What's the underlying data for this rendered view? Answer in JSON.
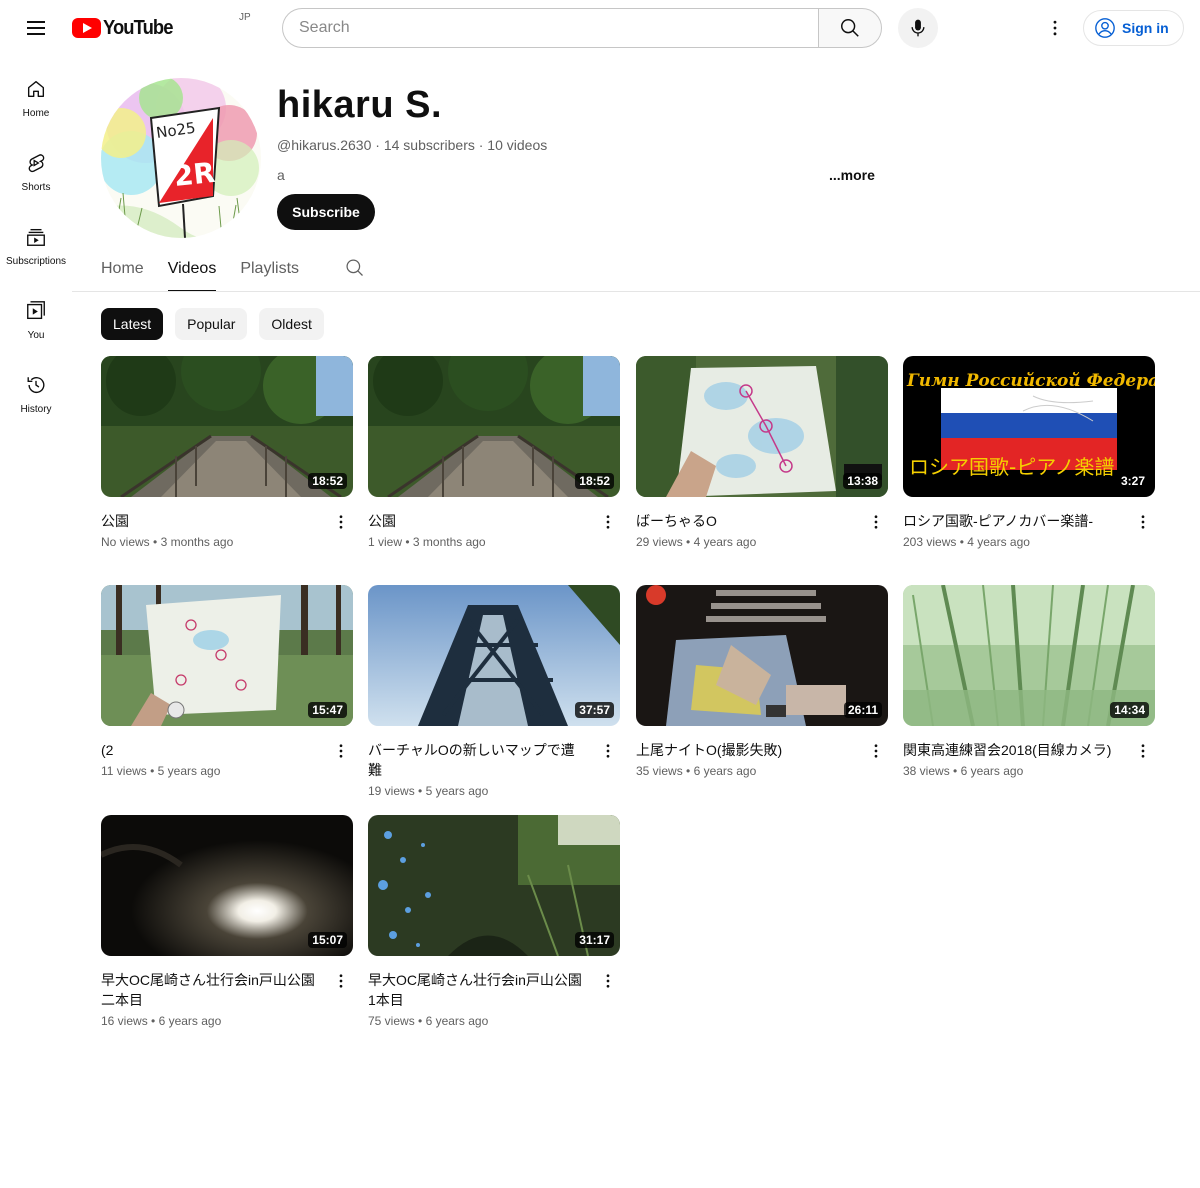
{
  "header": {
    "logo_text": "YouTube",
    "country_code": "JP",
    "search_placeholder": "Search",
    "sign_in_label": "Sign in"
  },
  "sidebar": {
    "items": [
      {
        "label": "Home",
        "icon": "home-icon"
      },
      {
        "label": "Shorts",
        "icon": "shorts-icon"
      },
      {
        "label": "Subscriptions",
        "icon": "subscriptions-icon"
      },
      {
        "label": "You",
        "icon": "you-icon"
      },
      {
        "label": "History",
        "icon": "history-icon"
      }
    ]
  },
  "channel": {
    "name": "hikaru S.",
    "meta": "@hikarus.2630 · 14 subscribers · 10 videos",
    "description": "a",
    "more_label": "...more",
    "subscribe_label": "Subscribe",
    "avatar_text_top": "No25",
    "avatar_text_mid": "2R"
  },
  "tabs": [
    {
      "label": "Home",
      "active": false
    },
    {
      "label": "Videos",
      "active": true
    },
    {
      "label": "Playlists",
      "active": false
    }
  ],
  "chips": [
    {
      "label": "Latest",
      "active": true
    },
    {
      "label": "Popular",
      "active": false
    },
    {
      "label": "Oldest",
      "active": false
    }
  ],
  "videos": [
    {
      "title": "公園",
      "views": "No views",
      "age": "3 months ago",
      "duration": "18:52"
    },
    {
      "title": "公園",
      "views": "1 view",
      "age": "3 months ago",
      "duration": "18:52"
    },
    {
      "title": "ばーちゃるO",
      "views": "29 views",
      "age": "4 years ago",
      "duration": "13:38"
    },
    {
      "title": "ロシア国歌-ピアノカバー楽譜-",
      "views": "203 views",
      "age": "4 years ago",
      "duration": "3:27",
      "overlay_top": "Гимн Российской Федерации",
      "overlay_bottom": "ロシア国歌-ピアノ楽譜"
    },
    {
      "title": "(2",
      "views": "11 views",
      "age": "5 years ago",
      "duration": "15:47"
    },
    {
      "title": "バーチャルOの新しいマップで遭難",
      "views": "19 views",
      "age": "5 years ago",
      "duration": "37:57"
    },
    {
      "title": "上尾ナイトO(撮影失敗)",
      "views": "35 views",
      "age": "6 years ago",
      "duration": "26:11"
    },
    {
      "title": "関東高連練習会2018(目線カメラ)",
      "views": "38 views",
      "age": "6 years ago",
      "duration": "14:34"
    },
    {
      "title": "早大OC尾崎さん壮行会in戸山公園二本目",
      "views": "16 views",
      "age": "6 years ago",
      "duration": "15:07"
    },
    {
      "title": "早大OC尾崎さん壮行会in戸山公園1本目",
      "views": "75 views",
      "age": "6 years ago",
      "duration": "31:17"
    }
  ],
  "colors": {
    "brand_red": "#ff0000",
    "link_blue": "#065fd4",
    "text_secondary": "#606060"
  }
}
